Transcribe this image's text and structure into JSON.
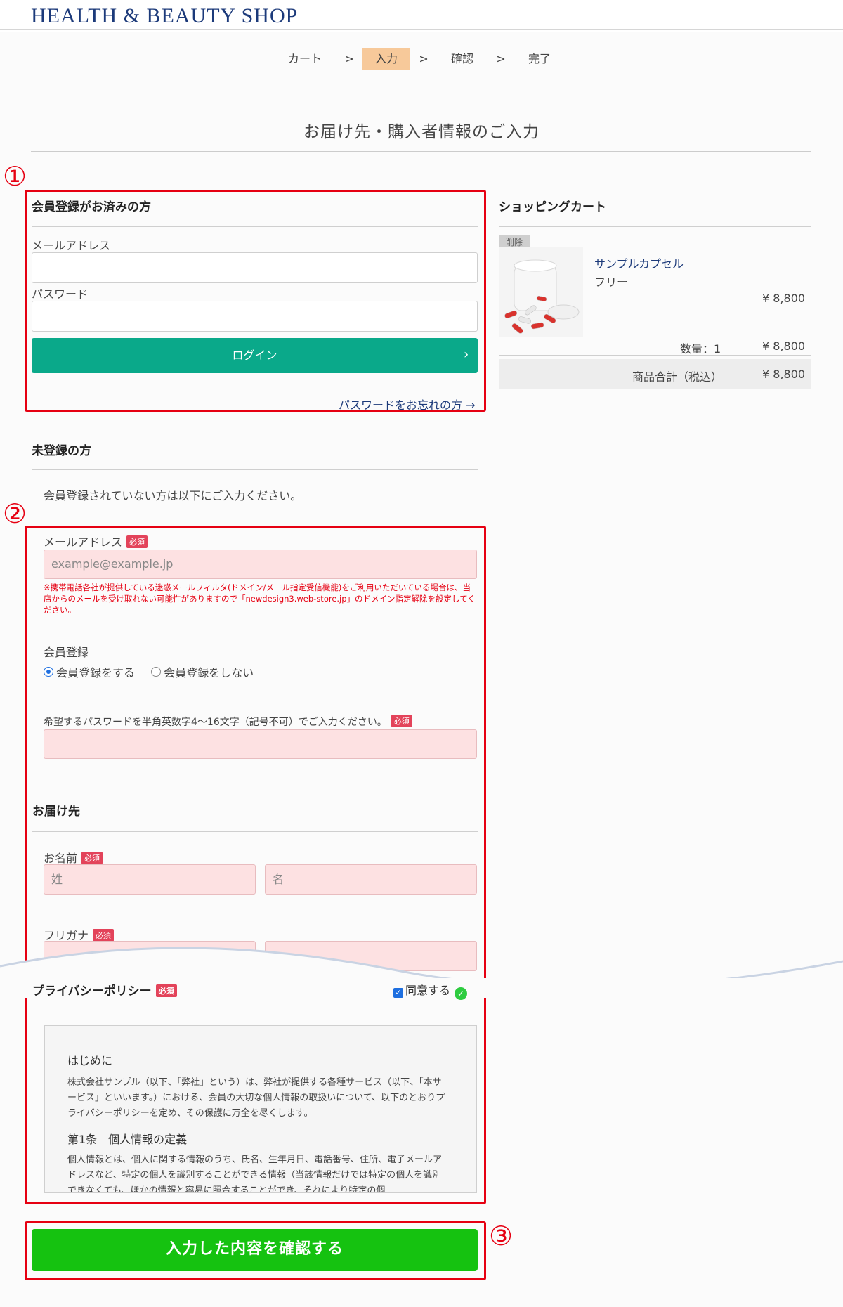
{
  "header": {
    "logo": "HEALTH & BEAUTY SHOP"
  },
  "steps": [
    {
      "label": "カート",
      "active": false
    },
    {
      "label": "入力",
      "active": true
    },
    {
      "label": "確認",
      "active": false
    },
    {
      "label": "完了",
      "active": false
    }
  ],
  "step_separator": ">",
  "page_title": "お届け先・購入者情報のご入力",
  "annotations": {
    "n1": "①",
    "n2": "②",
    "n3": "③"
  },
  "member_login": {
    "heading": "会員登録がお済みの方",
    "email_label": "メールアドレス",
    "email_value": "",
    "password_label": "パスワード",
    "password_value": "",
    "login_button": "ログイン",
    "forgot_link": "パスワードをお忘れの方 →"
  },
  "guest": {
    "heading": "未登録の方",
    "intro": "会員登録されていない方は以下にご入力ください。",
    "email_label": "メールアドレス",
    "required_badge": "必須",
    "email_placeholder": "example@example.jp",
    "warning": "※携帯電話各社が提供している迷惑メールフィルタ(ドメイン/メール指定受信機能)をご利用いただいている場合は、当店からのメールを受け取れない可能性がありますので「newdesign3.web-store.jp」のドメイン指定解除を設定してください。",
    "register_label": "会員登録",
    "register_options": [
      {
        "label": "会員登録をする",
        "selected": true
      },
      {
        "label": "会員登録をしない",
        "selected": false
      }
    ],
    "password_hint": "希望するパスワードを半角英数字4〜16文字（記号不可）でご入力ください。",
    "password_value": ""
  },
  "delivery": {
    "heading": "お届け先",
    "name_label": "お名前",
    "last_name_placeholder": "姓",
    "first_name_placeholder": "名",
    "kana_label": "フリガナ"
  },
  "privacy": {
    "heading": "プライバシーポリシー",
    "agree_label": "同意する",
    "agreed": true,
    "section1_title": "はじめに",
    "section1_text": "株式会社サンプル（以下、「弊社」という）は、弊社が提供する各種サービス（以下、「本サービス」といいます。）における、会員の大切な個人情報の取扱いについて、以下のとおりプライバシーポリシーを定め、その保護に万全を尽くします。",
    "section2_title": "第1条　個人情報の定義",
    "section2_text": "個人情報とは、個人に関する情報のうち、氏名、生年月日、電話番号、住所、電子メールアドレスなど、特定の個人を識別することができる情報（当該情報だけでは特定の個人を識別できなくても、ほかの情報と容易に照合することができ、それにより特定の個"
  },
  "submit_button": "入力した内容を確認する",
  "cart": {
    "heading": "ショッピングカート",
    "delete_label": "削除",
    "item_name": "サンプルカプセル",
    "item_variant": "フリー",
    "item_price": "¥ 8,800",
    "quantity_label": "数量：1",
    "line_total": "¥ 8,800",
    "subtotal_label": "商品合計（税込）",
    "subtotal_value": "¥ 8,800"
  },
  "colors": {
    "accent_red": "#e60012",
    "login_green": "#0aa98a",
    "submit_green": "#15c210",
    "required_pink": "#fde1e2"
  }
}
